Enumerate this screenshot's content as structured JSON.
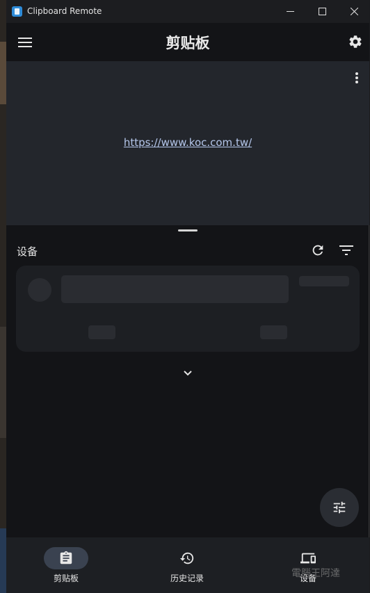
{
  "window": {
    "title": "Clipboard Remote"
  },
  "appbar": {
    "title": "剪贴板"
  },
  "clipboard": {
    "content": "https://www.koc.com.tw/"
  },
  "devices": {
    "section_title": "设备"
  },
  "nav": {
    "items": [
      {
        "label": "剪贴板",
        "icon": "clipboard-icon",
        "active": true
      },
      {
        "label": "历史记录",
        "icon": "history-icon",
        "active": false
      },
      {
        "label": "设备",
        "icon": "devices-icon",
        "active": false
      }
    ]
  },
  "watermark": "電腦王阿達",
  "colors": {
    "background": "#131417",
    "panel": "#23262c",
    "link": "#b4c6ea",
    "nav_active_pill": "#3a4250"
  }
}
